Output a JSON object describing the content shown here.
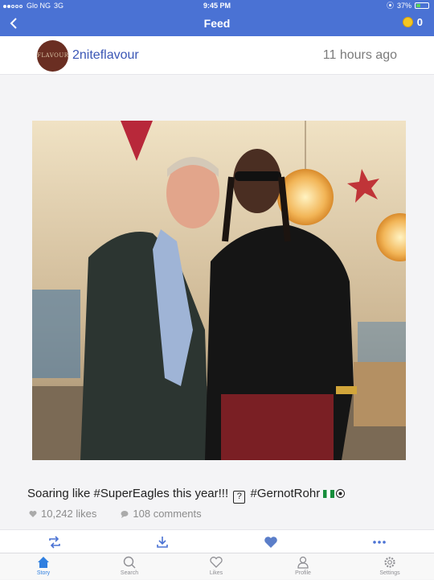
{
  "status_bar": {
    "carrier": "Glo NG",
    "network": "3G",
    "time": "9:45 PM",
    "battery": "37%",
    "battery_level": 0.37
  },
  "nav": {
    "title": "Feed",
    "coin_count": "0"
  },
  "post": {
    "avatar_text": "FLAVOUR",
    "username": "2niteflavour",
    "time_ago": "11 hours ago",
    "caption_before": "Soaring like #SuperEagles this year!!!",
    "caption_after": "#GernotRohr",
    "likes": "10,242 likes",
    "comments": "108 comments"
  },
  "tabs": [
    {
      "label": "Story",
      "icon": "home-icon",
      "active": true
    },
    {
      "label": "Search",
      "icon": "search-icon",
      "active": false
    },
    {
      "label": "Likes",
      "icon": "heart-icon",
      "active": false
    },
    {
      "label": "Profile",
      "icon": "person-icon",
      "active": false
    },
    {
      "label": "Settings",
      "icon": "gear-icon",
      "active": false
    }
  ],
  "colors": {
    "nav_bar": "#4a72d4",
    "username": "#3a56b5",
    "active_tab": "#2f7fe0"
  }
}
